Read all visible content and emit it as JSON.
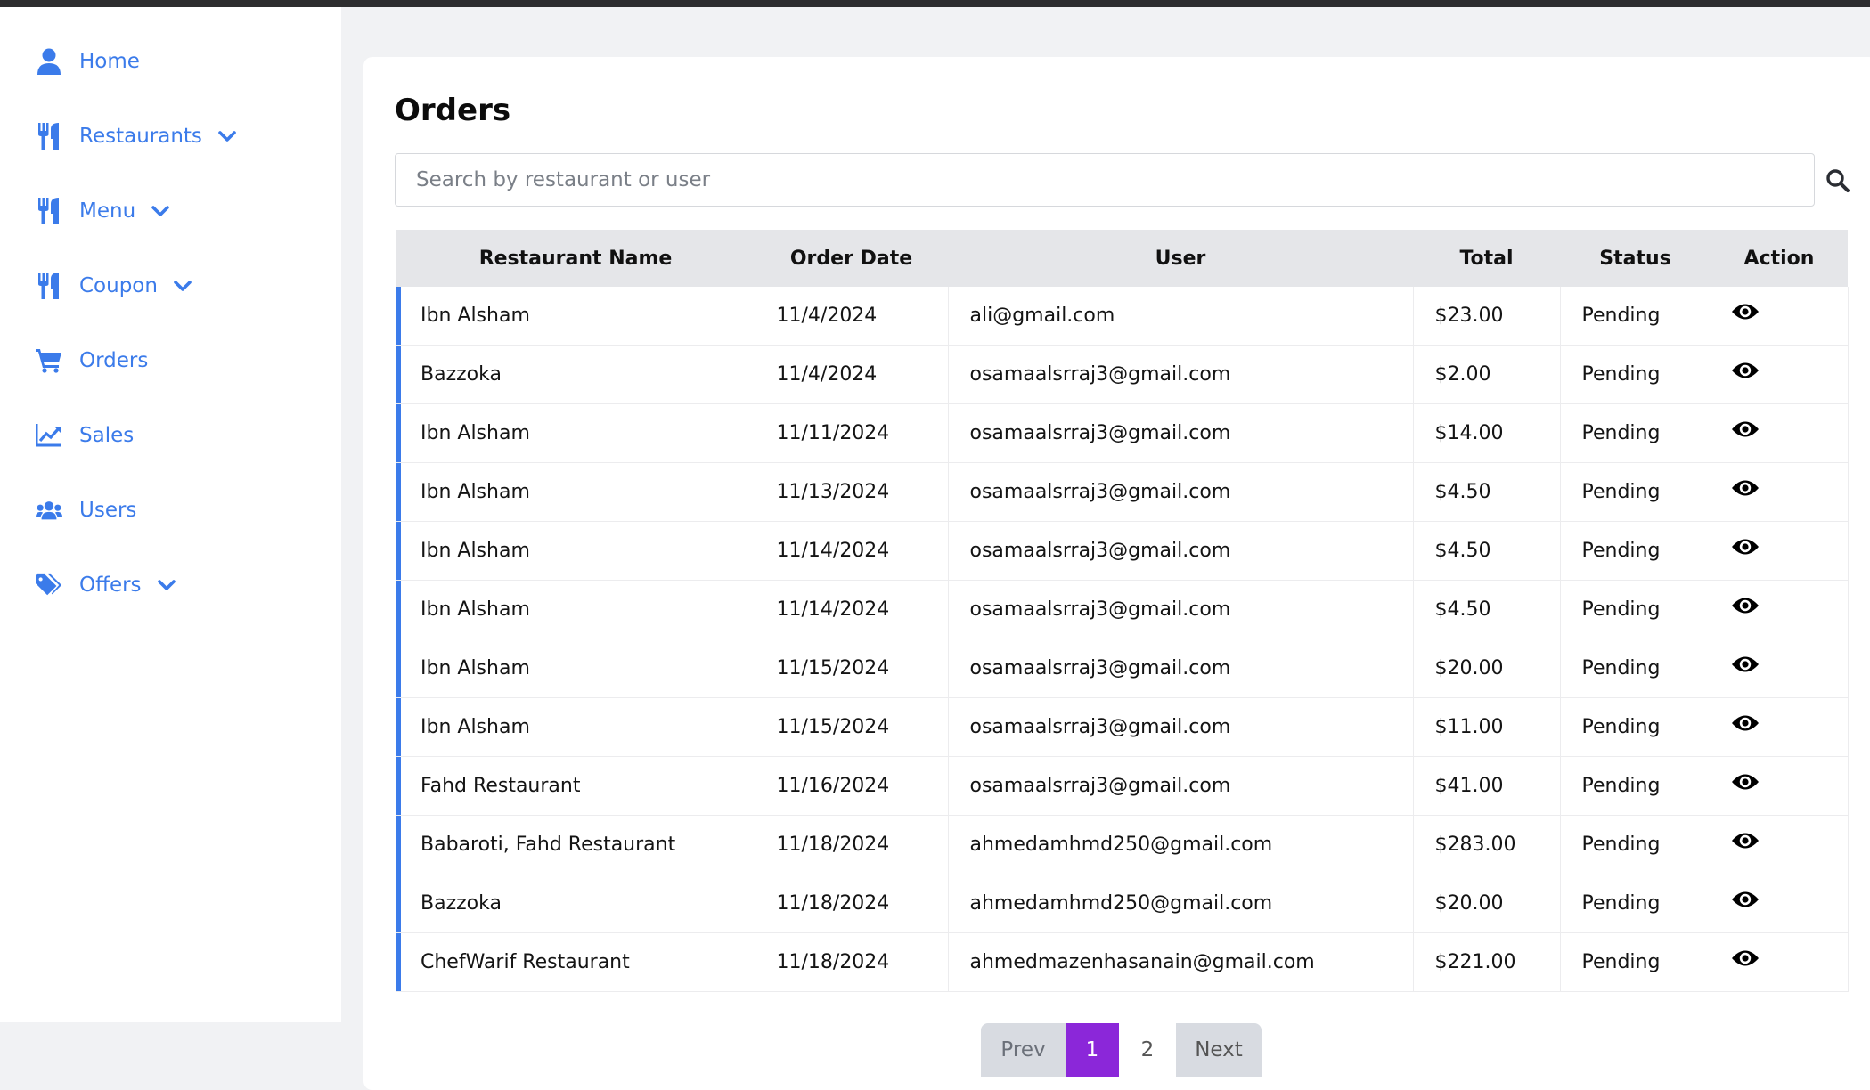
{
  "sidebar": {
    "items": [
      {
        "label": "Home",
        "icon": "user-icon",
        "dropdown": false
      },
      {
        "label": "Restaurants",
        "icon": "utensils-icon",
        "dropdown": true
      },
      {
        "label": "Menu",
        "icon": "utensils-icon",
        "dropdown": true
      },
      {
        "label": "Coupon",
        "icon": "utensils-icon",
        "dropdown": true
      },
      {
        "label": "Orders",
        "icon": "cart-icon",
        "dropdown": false
      },
      {
        "label": "Sales",
        "icon": "chart-line-icon",
        "dropdown": false
      },
      {
        "label": "Users",
        "icon": "users-icon",
        "dropdown": false
      },
      {
        "label": "Offers",
        "icon": "tags-icon",
        "dropdown": true
      }
    ]
  },
  "main": {
    "title": "Orders",
    "search": {
      "placeholder": "Search by restaurant or user",
      "value": ""
    },
    "table": {
      "headers": [
        "Restaurant Name",
        "Order Date",
        "User",
        "Total",
        "Status",
        "Action"
      ],
      "rows": [
        [
          "Ibn Alsham",
          "11/4/2024",
          "ali@gmail.com",
          "$23.00",
          "Pending"
        ],
        [
          "Bazzoka",
          "11/4/2024",
          "osamaalsrraj3@gmail.com",
          "$2.00",
          "Pending"
        ],
        [
          "Ibn Alsham",
          "11/11/2024",
          "osamaalsrraj3@gmail.com",
          "$14.00",
          "Pending"
        ],
        [
          "Ibn Alsham",
          "11/13/2024",
          "osamaalsrraj3@gmail.com",
          "$4.50",
          "Pending"
        ],
        [
          "Ibn Alsham",
          "11/14/2024",
          "osamaalsrraj3@gmail.com",
          "$4.50",
          "Pending"
        ],
        [
          "Ibn Alsham",
          "11/14/2024",
          "osamaalsrraj3@gmail.com",
          "$4.50",
          "Pending"
        ],
        [
          "Ibn Alsham",
          "11/15/2024",
          "osamaalsrraj3@gmail.com",
          "$20.00",
          "Pending"
        ],
        [
          "Ibn Alsham",
          "11/15/2024",
          "osamaalsrraj3@gmail.com",
          "$11.00",
          "Pending"
        ],
        [
          "Fahd Restaurant",
          "11/16/2024",
          "osamaalsrraj3@gmail.com",
          "$41.00",
          "Pending"
        ],
        [
          "Babaroti, Fahd Restaurant",
          "11/18/2024",
          "ahmedamhmd250@gmail.com",
          "$283.00",
          "Pending"
        ],
        [
          "Bazzoka",
          "11/18/2024",
          "ahmedamhmd250@gmail.com",
          "$20.00",
          "Pending"
        ],
        [
          "ChefWarif Restaurant",
          "11/18/2024",
          "ahmedmazenhasanain@gmail.com",
          "$221.00",
          "Pending"
        ]
      ]
    },
    "pagination": {
      "prev": "Prev",
      "pages": [
        "1",
        "2"
      ],
      "current": "1",
      "next": "Next"
    }
  },
  "colors": {
    "accent": "#3b7bea",
    "active_page": "#8b27d9",
    "header_bg": "#e5e6e9"
  }
}
